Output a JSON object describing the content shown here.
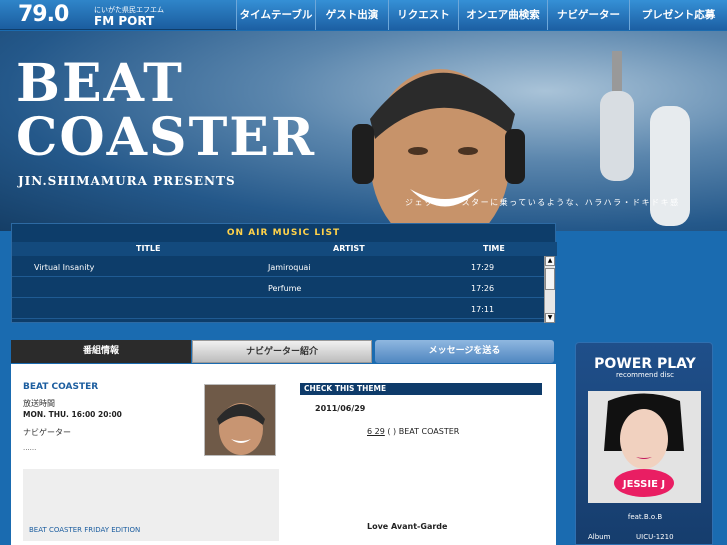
{
  "logo": {
    "number": "79.0",
    "sub": "にいがた県民エフエム",
    "name": "FM PORT"
  },
  "nav": [
    {
      "label": "タイムテーブル"
    },
    {
      "label": "ゲスト出演"
    },
    {
      "label": "リクエスト"
    },
    {
      "label": "オンエア曲検索"
    },
    {
      "label": "ナビゲーター"
    },
    {
      "label": "プレゼント応募"
    }
  ],
  "hero": {
    "title_line1": "BEAT",
    "title_line2": "COASTER",
    "presents": "JIN.SHIMAMURA PRESENTS",
    "tagline": "ジェットコースターに乗っているような、ハラハラ・ドキドキ感"
  },
  "onair": {
    "title": "ON AIR MUSIC LIST",
    "headers": {
      "title": "TITLE",
      "artist": "ARTIST",
      "time": "TIME"
    },
    "rows": [
      {
        "title": "Virtual Insanity",
        "artist": "Jamiroquai",
        "time": "17:29"
      },
      {
        "title": "",
        "artist": "Perfume",
        "time": "17:26"
      },
      {
        "title": "",
        "artist": "",
        "time": "17:11"
      }
    ]
  },
  "tabs": {
    "info": "番組情報",
    "navigator": "ナビゲーター紹介",
    "message": "メッセージを送る"
  },
  "program": {
    "name": "BEAT COASTER",
    "time_label": "放送時間",
    "time_value": "MON. THU. 16:00  20:00",
    "navi_label": "ナビゲーター",
    "navi_value": "......",
    "friday": "BEAT COASTER FRIDAY EDITION"
  },
  "theme": {
    "header": "CHECK THIS THEME",
    "date": "2011/06/29",
    "date_link": "6  29",
    "paren": "(  )",
    "body": "BEAT COASTER",
    "song": "Love Avant-Garde"
  },
  "power_play": {
    "title": "POWER PLAY",
    "subtitle": "recommend disc",
    "artist": "feat.B.o.B",
    "album_label": "Album",
    "album_value": "UICU-1210",
    "cover_text": "JESSIE J"
  }
}
